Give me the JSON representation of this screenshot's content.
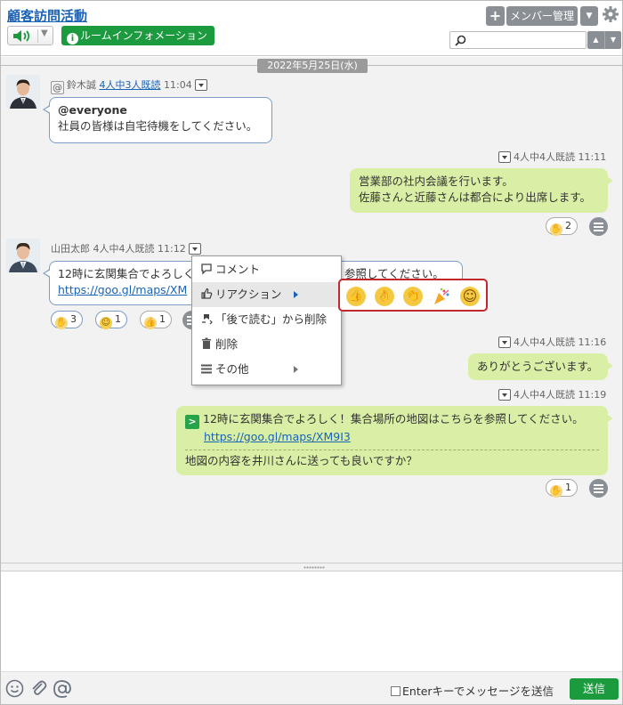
{
  "header": {
    "room_title": "顧客訪問活動",
    "room_info_label": "ルームインフォメーション",
    "add_label": "+",
    "member_label": "メンバー管理",
    "search_placeholder": "",
    "search_value": ""
  },
  "chat": {
    "date_label": "2022年5月25日(水)",
    "messages": [
      {
        "sender": "鈴木誠",
        "read_status": "4人中3人既読",
        "time": "11:04",
        "lines": [
          "@everyone",
          "社員の皆様は自宅待機をしてください。"
        ]
      },
      {
        "read_status": "4人中4人既読",
        "time": "11:11",
        "lines": [
          "営業部の社内会議を行います。",
          "佐藤さんと近藤さんは都合により出席します。"
        ],
        "reactions": [
          {
            "icon": "clap-emoji",
            "count": "2"
          }
        ]
      },
      {
        "sender": "山田太郎",
        "read_status": "4人中4人既読",
        "time": "11:12",
        "line1_start": "12時に玄関集合でよろしく",
        "line1_end": "参照してください。",
        "link": "https://goo.gl/maps/XM",
        "reactions": [
          {
            "icon": "clap-emoji",
            "count": "3"
          },
          {
            "icon": "smile-emoji",
            "count": "1"
          },
          {
            "icon": "thumbs-up-emoji",
            "count": "1"
          }
        ]
      },
      {
        "read_status": "4人中4人既読",
        "time": "11:16",
        "lines": [
          "ありがとうございます。"
        ]
      },
      {
        "read_status": "4人中4人既読",
        "time": "11:19",
        "quote_text": "12時に玄関集合でよろしく！集合場所の地図はこちらを参照してください。",
        "quote_link": "https://goo.gl/maps/XM9I3",
        "reply": "地図の内容を井川さんに送っても良いですか？",
        "reactions": [
          {
            "icon": "clap-emoji",
            "count": "1"
          }
        ]
      }
    ]
  },
  "context_menu": {
    "items": [
      {
        "label": "コメント",
        "icon": "comment-icon"
      },
      {
        "label": "リアクション",
        "icon": "thumbs-up-icon"
      },
      {
        "label": "「後で読む」から削除",
        "icon": "pin-remove-icon"
      },
      {
        "label": "削除",
        "icon": "trash-icon"
      },
      {
        "label": "その他",
        "icon": "list-icon"
      }
    ]
  },
  "reaction_picker": [
    "thumbs-up-emoji",
    "ok-hand-emoji",
    "clap-emoji",
    "party-popper-emoji",
    "smile-emoji"
  ],
  "composer": {
    "message_value": "",
    "enter_to_send_label": "Enterキーでメッセージを送信",
    "send_label": "送信"
  },
  "colors": {
    "accent_green": "#1b9a3e",
    "link_blue": "#1a63b6",
    "outgoing_bubble": "#d9efa6",
    "highlight_red": "#c0282d"
  }
}
